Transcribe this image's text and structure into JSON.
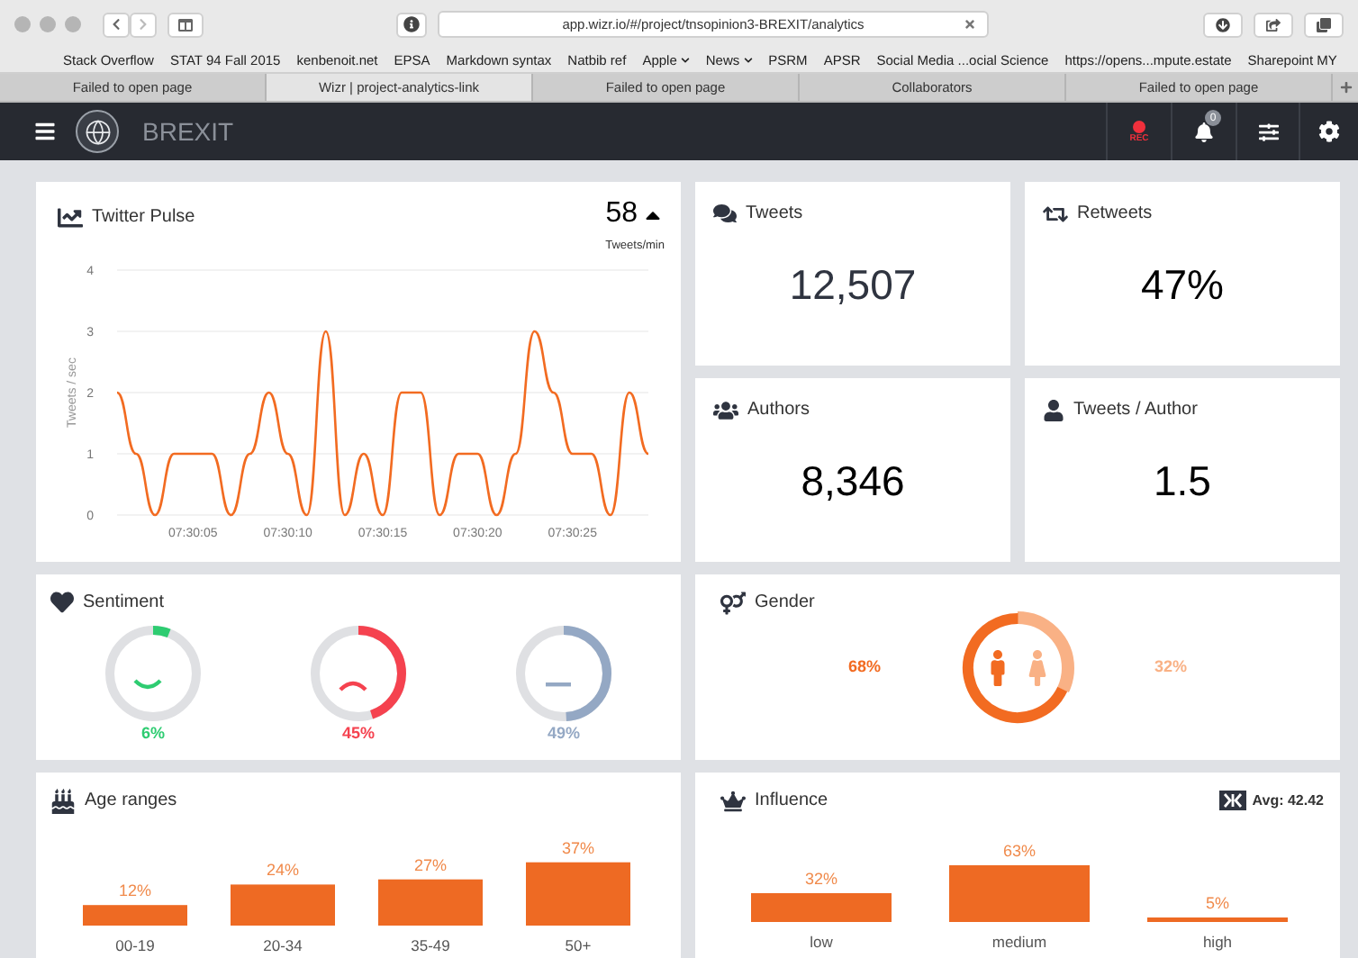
{
  "browser": {
    "address": "app.wizr.io/#/project/tnsopinion3-BREXIT/analytics",
    "bookmarks": [
      {
        "label": "Stack Overflow",
        "menu": false
      },
      {
        "label": "STAT 94 Fall 2015",
        "menu": false
      },
      {
        "label": "kenbenoit.net",
        "menu": false
      },
      {
        "label": "EPSA",
        "menu": false
      },
      {
        "label": "Markdown syntax",
        "menu": false
      },
      {
        "label": "Natbib ref",
        "menu": false
      },
      {
        "label": "Apple",
        "menu": true
      },
      {
        "label": "News",
        "menu": true
      },
      {
        "label": "PSRM",
        "menu": false
      },
      {
        "label": "APSR",
        "menu": false
      },
      {
        "label": "Social Media ...ocial Science",
        "menu": false
      },
      {
        "label": "https://opens...mpute.estate",
        "menu": false
      },
      {
        "label": "Sharepoint MY",
        "menu": false
      }
    ],
    "tabs": [
      {
        "label": "Failed to open page",
        "selected": false
      },
      {
        "label": "Wizr | project-analytics-link",
        "selected": true
      },
      {
        "label": "Failed to open page",
        "selected": false
      },
      {
        "label": "Collaborators",
        "selected": false
      },
      {
        "label": "Failed to open page",
        "selected": false
      }
    ]
  },
  "app_header": {
    "title": "BREXIT",
    "rec_label": "REC",
    "notification_count": "0"
  },
  "twitter_pulse": {
    "title": "Twitter Pulse",
    "rate": "58",
    "rate_unit": "Tweets/min",
    "chart_data": {
      "type": "line",
      "ylabel": "Tweets / sec",
      "categories": [
        null,
        null,
        null,
        null,
        "07:30:05",
        null,
        null,
        null,
        null,
        "07:30:10",
        null,
        null,
        null,
        null,
        "07:30:15",
        null,
        null,
        null,
        null,
        "07:30:20",
        null,
        null,
        null,
        null,
        "07:30:25",
        null,
        null,
        null,
        null
      ],
      "series": [
        {
          "color": "#f26b21",
          "values": [
            2,
            1,
            0,
            1,
            1,
            1,
            0,
            1,
            2,
            1,
            0,
            3,
            0,
            1,
            0,
            2,
            2,
            0,
            1,
            1,
            0,
            1,
            3,
            2,
            1,
            1,
            0,
            2,
            1
          ]
        }
      ],
      "ylim": [
        0,
        4
      ],
      "yticks": [
        0,
        1,
        2,
        3,
        4
      ],
      "grid": true
    }
  },
  "stats": [
    {
      "kind": "tweets",
      "label": "Tweets",
      "value": "12,507"
    },
    {
      "kind": "retweets",
      "label": "Retweets",
      "value": "47%"
    },
    {
      "kind": "authors",
      "label": "Authors",
      "value": "8,346"
    },
    {
      "kind": "tweets_per_author",
      "label": "Tweets / Author",
      "value": "1.5"
    }
  ],
  "sentiment": {
    "title": "Sentiment",
    "items": [
      {
        "kind": "positive",
        "label": "6%",
        "level": 0.06,
        "color": "#2ecc71"
      },
      {
        "kind": "negative",
        "label": "45%",
        "level": 0.45,
        "color": "#f5424f"
      },
      {
        "kind": "neutral",
        "label": "49%",
        "level": 0.49,
        "color": "#94a8c4"
      }
    ]
  },
  "gender": {
    "title": "Gender",
    "items": [
      {
        "kind": "male",
        "label": "68%",
        "level": 0.68,
        "color": "#f26b21"
      },
      {
        "kind": "female",
        "label": "32%",
        "level": 0.32,
        "color": "#f9b185"
      }
    ]
  },
  "age_ranges": {
    "title": "Age ranges",
    "chart_data": {
      "type": "bar",
      "categories": [
        "00-19",
        "20-34",
        "35-49",
        "50+"
      ],
      "values": [
        12,
        24,
        27,
        37
      ],
      "value_labels": [
        "12%",
        "24%",
        "27%",
        "37%"
      ]
    }
  },
  "influence": {
    "title": "Influence",
    "average": "Avg: 42.42",
    "chart_data": {
      "type": "bar",
      "categories": [
        "low",
        "medium",
        "high"
      ],
      "values": [
        32,
        63,
        5
      ],
      "value_labels": [
        "32%",
        "63%",
        "5%"
      ]
    }
  }
}
